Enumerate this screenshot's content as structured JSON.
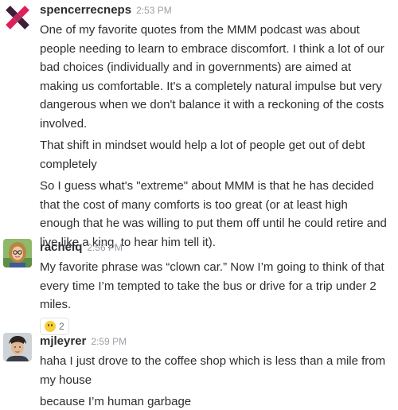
{
  "messages": [
    {
      "author": "spencerrecneps",
      "time": "2:53 PM",
      "avatar_icon": "pinwheel-logo-avatar",
      "paragraphs": [
        "One of my favorite quotes from the MMM podcast was about people needing to learn to embrace discomfort. I think a lot of our bad choices (individually and in governments) are aimed at making us comfortable. It's a completely natural impulse but very dangerous when we don't balance it with a reckoning of the costs involved.",
        "That shift in mindset would help a lot of people get out of debt completely",
        "So I guess what's \"extreme\" about MMM is that he has decided that the cost of many comforts is too great (or at least high enough that he was willing to put them off until he could retire and live like a king, to hear him tell it)."
      ]
    },
    {
      "author": "rachelq",
      "time": "2:56 PM",
      "avatar_icon": "woman-with-glasses-photo-avatar",
      "paragraphs": [
        "My favorite phrase was “clown car.” Now I’m going to think of that every time I’m tempted to take the bus or drive for a trip under 2 miles."
      ],
      "reaction": {
        "emoji": "slightly-smiling-face-icon",
        "count": "2"
      }
    },
    {
      "author": "mjleyrer",
      "time": "2:59 PM",
      "avatar_icon": "man-photo-avatar",
      "paragraphs": [
        "haha I just drove to the coffee shop which is less than a mile from my house",
        "because I’m human garbage"
      ]
    }
  ],
  "colors": {
    "author": "#2c2d30",
    "timestamp": "#9e9ea6",
    "text": "#2c2d30",
    "pinwheel_red": "#e01e5a",
    "pinwheel_dark": "#3b1f3b",
    "emoji_yellow": "#f8cf3c"
  }
}
